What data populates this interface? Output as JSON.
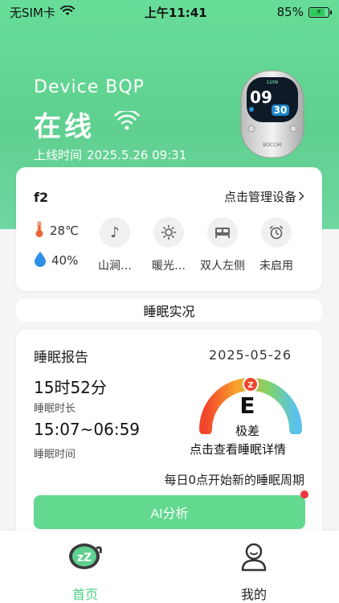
{
  "status_bar": {
    "carrier": "无SIM卡",
    "time": "上午11:41",
    "battery": "85%"
  },
  "device": {
    "name": "Device BQP",
    "status": "在线",
    "online_label": "上线时间",
    "online_time": "2025.5.26 09:31",
    "screen_hour": "09",
    "screen_minute": "30",
    "brand": "BOCCHI"
  },
  "device_card": {
    "id": "f2",
    "manage_link": "点击管理设备",
    "temperature": "28℃",
    "humidity": "40%",
    "modes": [
      {
        "icon": "music-note-icon",
        "label": "山涧…"
      },
      {
        "icon": "sun-icon",
        "label": "暖光…"
      },
      {
        "icon": "bed-icon",
        "label": "双人左侧"
      },
      {
        "icon": "alarm-clock-icon",
        "label": "未启用"
      }
    ]
  },
  "section_title": "睡眠实况",
  "sleep": {
    "report_title": "睡眠报告",
    "date": "2025-05-26",
    "duration": "15时52分",
    "duration_label": "睡眠时长",
    "time_range": "15:07~06:59",
    "time_label": "睡眠时间",
    "grade": "E",
    "grade_text": "极差",
    "gauge_marker": "Z",
    "detail_link": "点击查看睡眠详情",
    "cycle_note": "每日0点开始新的睡眠周期",
    "ai_button": "AI分析",
    "colors": {
      "gauge_red": "#f2452c",
      "gauge_orange": "#f7a32b",
      "gauge_green": "#7fd36a",
      "gauge_blue": "#5bc2ee",
      "accent": "#63d88f"
    }
  },
  "tabbar": {
    "tabs": [
      {
        "label": "首页",
        "icon": "sleep-z-icon",
        "active": true
      },
      {
        "label": "我的",
        "icon": "user-icon",
        "active": false
      }
    ]
  }
}
